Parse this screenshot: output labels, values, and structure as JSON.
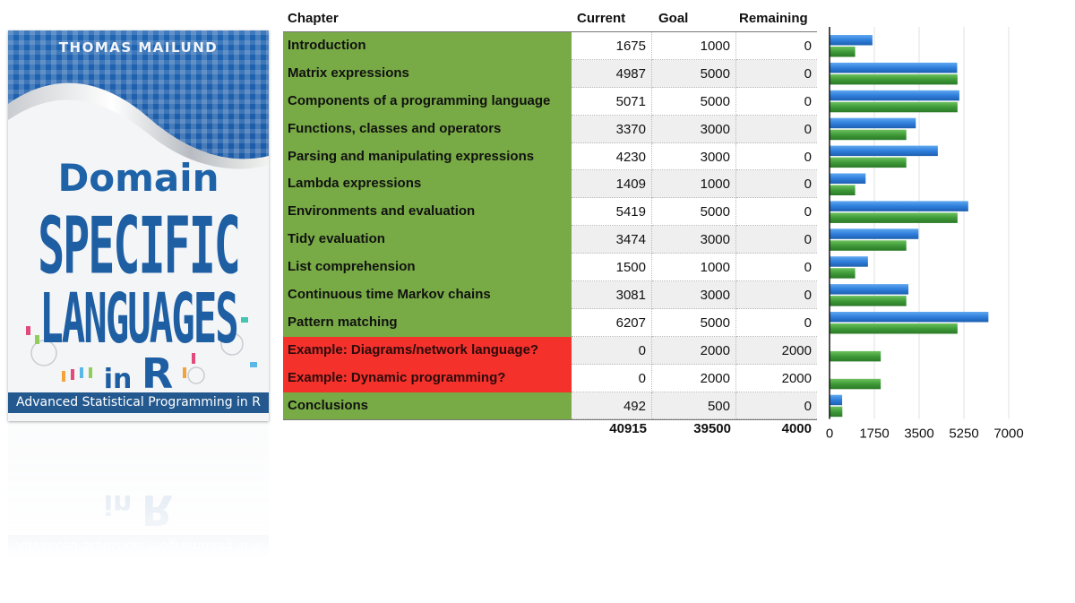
{
  "cover": {
    "author": "THOMAS MAILUND",
    "title_line1": "Domain",
    "title_line2": "SPECIFIC",
    "title_line3": "LANGUAGES",
    "title_in": "in",
    "title_r": "R",
    "subtitle": "Advanced Statistical Programming in R",
    "colors": {
      "blue": "#1e5ea3",
      "band": "#23598f"
    }
  },
  "table": {
    "headers": {
      "chapter": "Chapter",
      "current": "Current",
      "goal": "Goal",
      "remaining": "Remaining"
    },
    "rows": [
      {
        "chapter": "Introduction",
        "current": "1675",
        "goal": "1000",
        "remaining": "0",
        "status": "done"
      },
      {
        "chapter": "Matrix expressions",
        "current": "4987",
        "goal": "5000",
        "remaining": "0",
        "status": "done"
      },
      {
        "chapter": "Components of a programming language",
        "current": "5071",
        "goal": "5000",
        "remaining": "0",
        "status": "done"
      },
      {
        "chapter": "Functions, classes and operators",
        "current": "3370",
        "goal": "3000",
        "remaining": "0",
        "status": "done"
      },
      {
        "chapter": "Parsing and manipulating expressions",
        "current": "4230",
        "goal": "3000",
        "remaining": "0",
        "status": "done"
      },
      {
        "chapter": "Lambda expressions",
        "current": "1409",
        "goal": "1000",
        "remaining": "0",
        "status": "done"
      },
      {
        "chapter": "Environments and evaluation",
        "current": "5419",
        "goal": "5000",
        "remaining": "0",
        "status": "done"
      },
      {
        "chapter": "Tidy evaluation",
        "current": "3474",
        "goal": "3000",
        "remaining": "0",
        "status": "done"
      },
      {
        "chapter": "List comprehension",
        "current": "1500",
        "goal": "1000",
        "remaining": "0",
        "status": "done"
      },
      {
        "chapter": "Continuous time Markov chains",
        "current": "3081",
        "goal": "3000",
        "remaining": "0",
        "status": "done"
      },
      {
        "chapter": "Pattern matching",
        "current": "6207",
        "goal": "5000",
        "remaining": "0",
        "status": "done"
      },
      {
        "chapter": "Example: Diagrams/network language?",
        "current": "0",
        "goal": "2000",
        "remaining": "2000",
        "status": "todo"
      },
      {
        "chapter": "Example: Dynamic programming?",
        "current": "0",
        "goal": "2000",
        "remaining": "2000",
        "status": "todo"
      },
      {
        "chapter": "Conclusions",
        "current": "492",
        "goal": "500",
        "remaining": "0",
        "status": "done"
      }
    ],
    "totals": {
      "current": "40915",
      "goal": "39500",
      "remaining": "4000"
    },
    "colors": {
      "done": "#78ab45",
      "todo": "#f5312c"
    }
  },
  "chart_data": {
    "type": "bar",
    "orientation": "horizontal",
    "title": "",
    "xlabel": "",
    "ylabel": "",
    "categories": [
      "Introduction",
      "Matrix expressions",
      "Components of a programming language",
      "Functions, classes and operators",
      "Parsing and manipulating expressions",
      "Lambda expressions",
      "Environments and evaluation",
      "Tidy evaluation",
      "List comprehension",
      "Continuous time Markov chains",
      "Pattern matching",
      "Example: Diagrams/network language?",
      "Example: Dynamic programming?",
      "Conclusions"
    ],
    "series": [
      {
        "name": "Current",
        "color": "#2f7fdc",
        "values": [
          1675,
          4987,
          5071,
          3370,
          4230,
          1409,
          5419,
          3474,
          1500,
          3081,
          6207,
          0,
          0,
          492
        ]
      },
      {
        "name": "Goal",
        "color": "#3f9a38",
        "values": [
          1000,
          5000,
          5000,
          3000,
          3000,
          1000,
          5000,
          3000,
          1000,
          3000,
          5000,
          2000,
          2000,
          500
        ]
      }
    ],
    "xlim": [
      0,
      7000
    ],
    "xticks": [
      "0",
      "1750",
      "3500",
      "5250",
      "7000"
    ],
    "grid": true,
    "legend": "none"
  }
}
